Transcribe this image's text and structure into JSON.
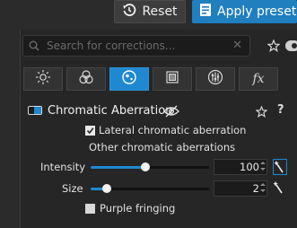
{
  "toolbar": {
    "reset_label": "Reset",
    "apply_preset_label": "Apply preset"
  },
  "search": {
    "placeholder": "Search for corrections..."
  },
  "tabs": [
    {
      "icon": "sun-icon",
      "active": false
    },
    {
      "icon": "circles-icon",
      "active": false
    },
    {
      "icon": "lens-icon",
      "active": true
    },
    {
      "icon": "frame-icon",
      "active": false
    },
    {
      "icon": "equalizer-icon",
      "active": false
    },
    {
      "icon": "fx-icon",
      "label": "fx",
      "active": false
    }
  ],
  "section": {
    "title": "Chromatic Aberration",
    "help": "?",
    "lateral_label": "Lateral chromatic aberration",
    "lateral_checked": true,
    "other_label": "Other chromatic aberrations",
    "intensity_label": "Intensity",
    "intensity_value": "100",
    "intensity_fraction": 0.46,
    "size_label": "Size",
    "size_value": "2",
    "size_fraction": 0.14,
    "fringing_label": "Purple fringing",
    "fringing_checked": false
  },
  "colors": {
    "accent": "#1e88d0",
    "background": "#2b2b2b"
  }
}
